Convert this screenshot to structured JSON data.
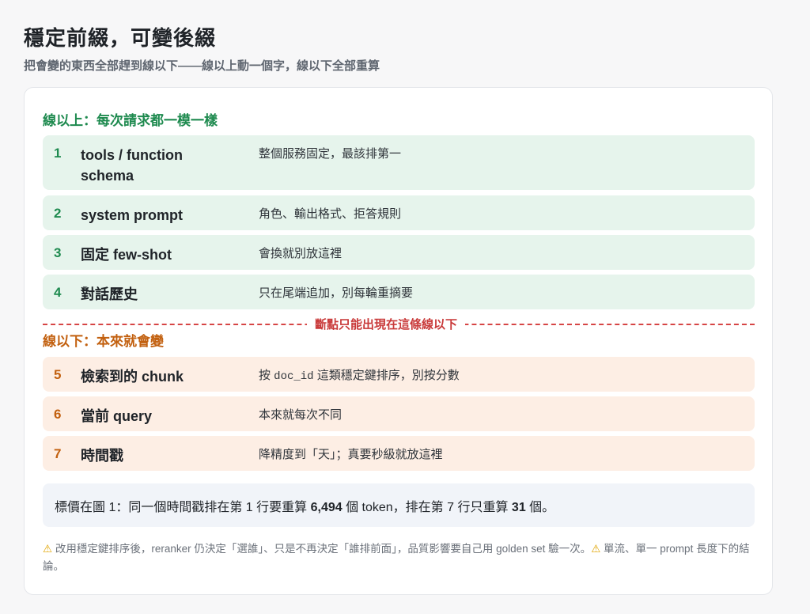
{
  "page": {
    "title": "穩定前綴，可變後綴",
    "subtitle": "把會變的東西全部趕到線以下——線以上動一個字，線以下全部重算"
  },
  "above": {
    "label": "線以上：每次請求都一模一樣",
    "rows": [
      {
        "num": "1",
        "name": "tools / function schema",
        "desc": "整個服務固定，最該排第一"
      },
      {
        "num": "2",
        "name": "system prompt",
        "desc": "角色、輸出格式、拒答規則"
      },
      {
        "num": "3",
        "name": "固定 few-shot",
        "desc": "會換就別放這裡"
      },
      {
        "num": "4",
        "name": "對話歷史",
        "desc": "只在尾端追加，別每輪重摘要"
      }
    ]
  },
  "divider": {
    "label": "斷點只能出現在這條線以下"
  },
  "below": {
    "label": "線以下：本來就會變",
    "rows": [
      {
        "num": "5",
        "name": "檢索到的 chunk",
        "desc_pre": "按 ",
        "desc_code": "doc_id",
        "desc_post": " 這類穩定鍵排序，別按分數"
      },
      {
        "num": "6",
        "name": "當前 query",
        "desc": "本來就每次不同"
      },
      {
        "num": "7",
        "name": "時間戳",
        "desc": "降精度到「天」；真要秒級就放這裡"
      }
    ]
  },
  "note": {
    "part1": "標價在圖 1：同一個時間戳排在第 1 行要重算 ",
    "tokens_a": "6,494",
    "part2": " 個 token，排在第 7 行只重算 ",
    "tokens_b": "31",
    "part3": " 個。"
  },
  "footer": {
    "warn_icon": "⚠",
    "text1": " 改用穩定鍵排序後，reranker 仍決定「選誰」、只是不再決定「誰排前面」，品質影響要自己用 golden set 驗一次。",
    "text2": " 單流、單一 prompt 長度下的結論。"
  },
  "colors": {
    "green": "#1e8a4f",
    "orange": "#c2600f",
    "red": "#d64545"
  }
}
